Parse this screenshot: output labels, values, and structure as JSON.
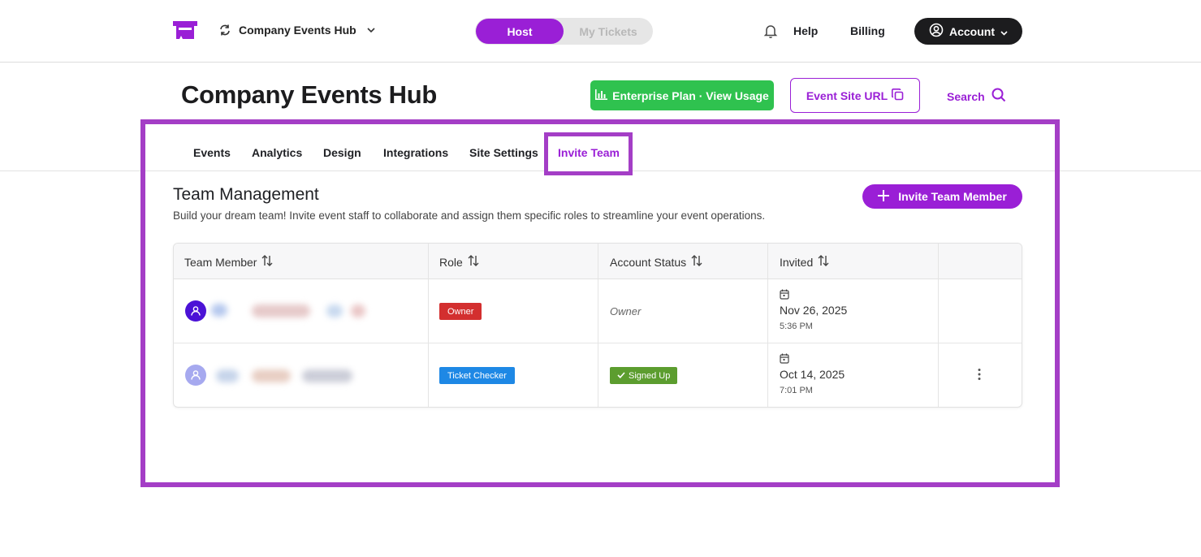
{
  "colors": {
    "brand": "#9a1fd6",
    "plan_green": "#2fc24f",
    "highlight": "#a43ec6",
    "owner_red": "#d32f2f",
    "checker_blue": "#1e88e5",
    "signed_green": "#5c9d2f"
  },
  "header": {
    "org_name": "Company Events Hub",
    "toggle": {
      "host": "Host",
      "tickets": "My Tickets"
    },
    "help": "Help",
    "billing": "Billing",
    "account": "Account"
  },
  "page": {
    "title": "Company Events Hub",
    "plan_button": "Enterprise Plan · View Usage",
    "site_url_button": "Event Site URL",
    "search": "Search"
  },
  "tabs": [
    {
      "label": "Events"
    },
    {
      "label": "Analytics"
    },
    {
      "label": "Design"
    },
    {
      "label": "Integrations"
    },
    {
      "label": "Site Settings"
    },
    {
      "label": "Invite Team",
      "active": true
    }
  ],
  "section": {
    "title": "Team Management",
    "description": "Build your dream team! Invite event staff to collaborate and assign them specific roles to streamline your event operations.",
    "invite_button": "Invite Team Member"
  },
  "table": {
    "columns": [
      "Team Member",
      "Role",
      "Account Status",
      "Invited"
    ],
    "rows": [
      {
        "role": "Owner",
        "status": "Owner",
        "date": "Nov 26, 2025",
        "time": "5:36 PM"
      },
      {
        "role": "Ticket Checker",
        "status": "Signed Up",
        "date": "Oct 14, 2025",
        "time": "7:01 PM"
      }
    ]
  }
}
